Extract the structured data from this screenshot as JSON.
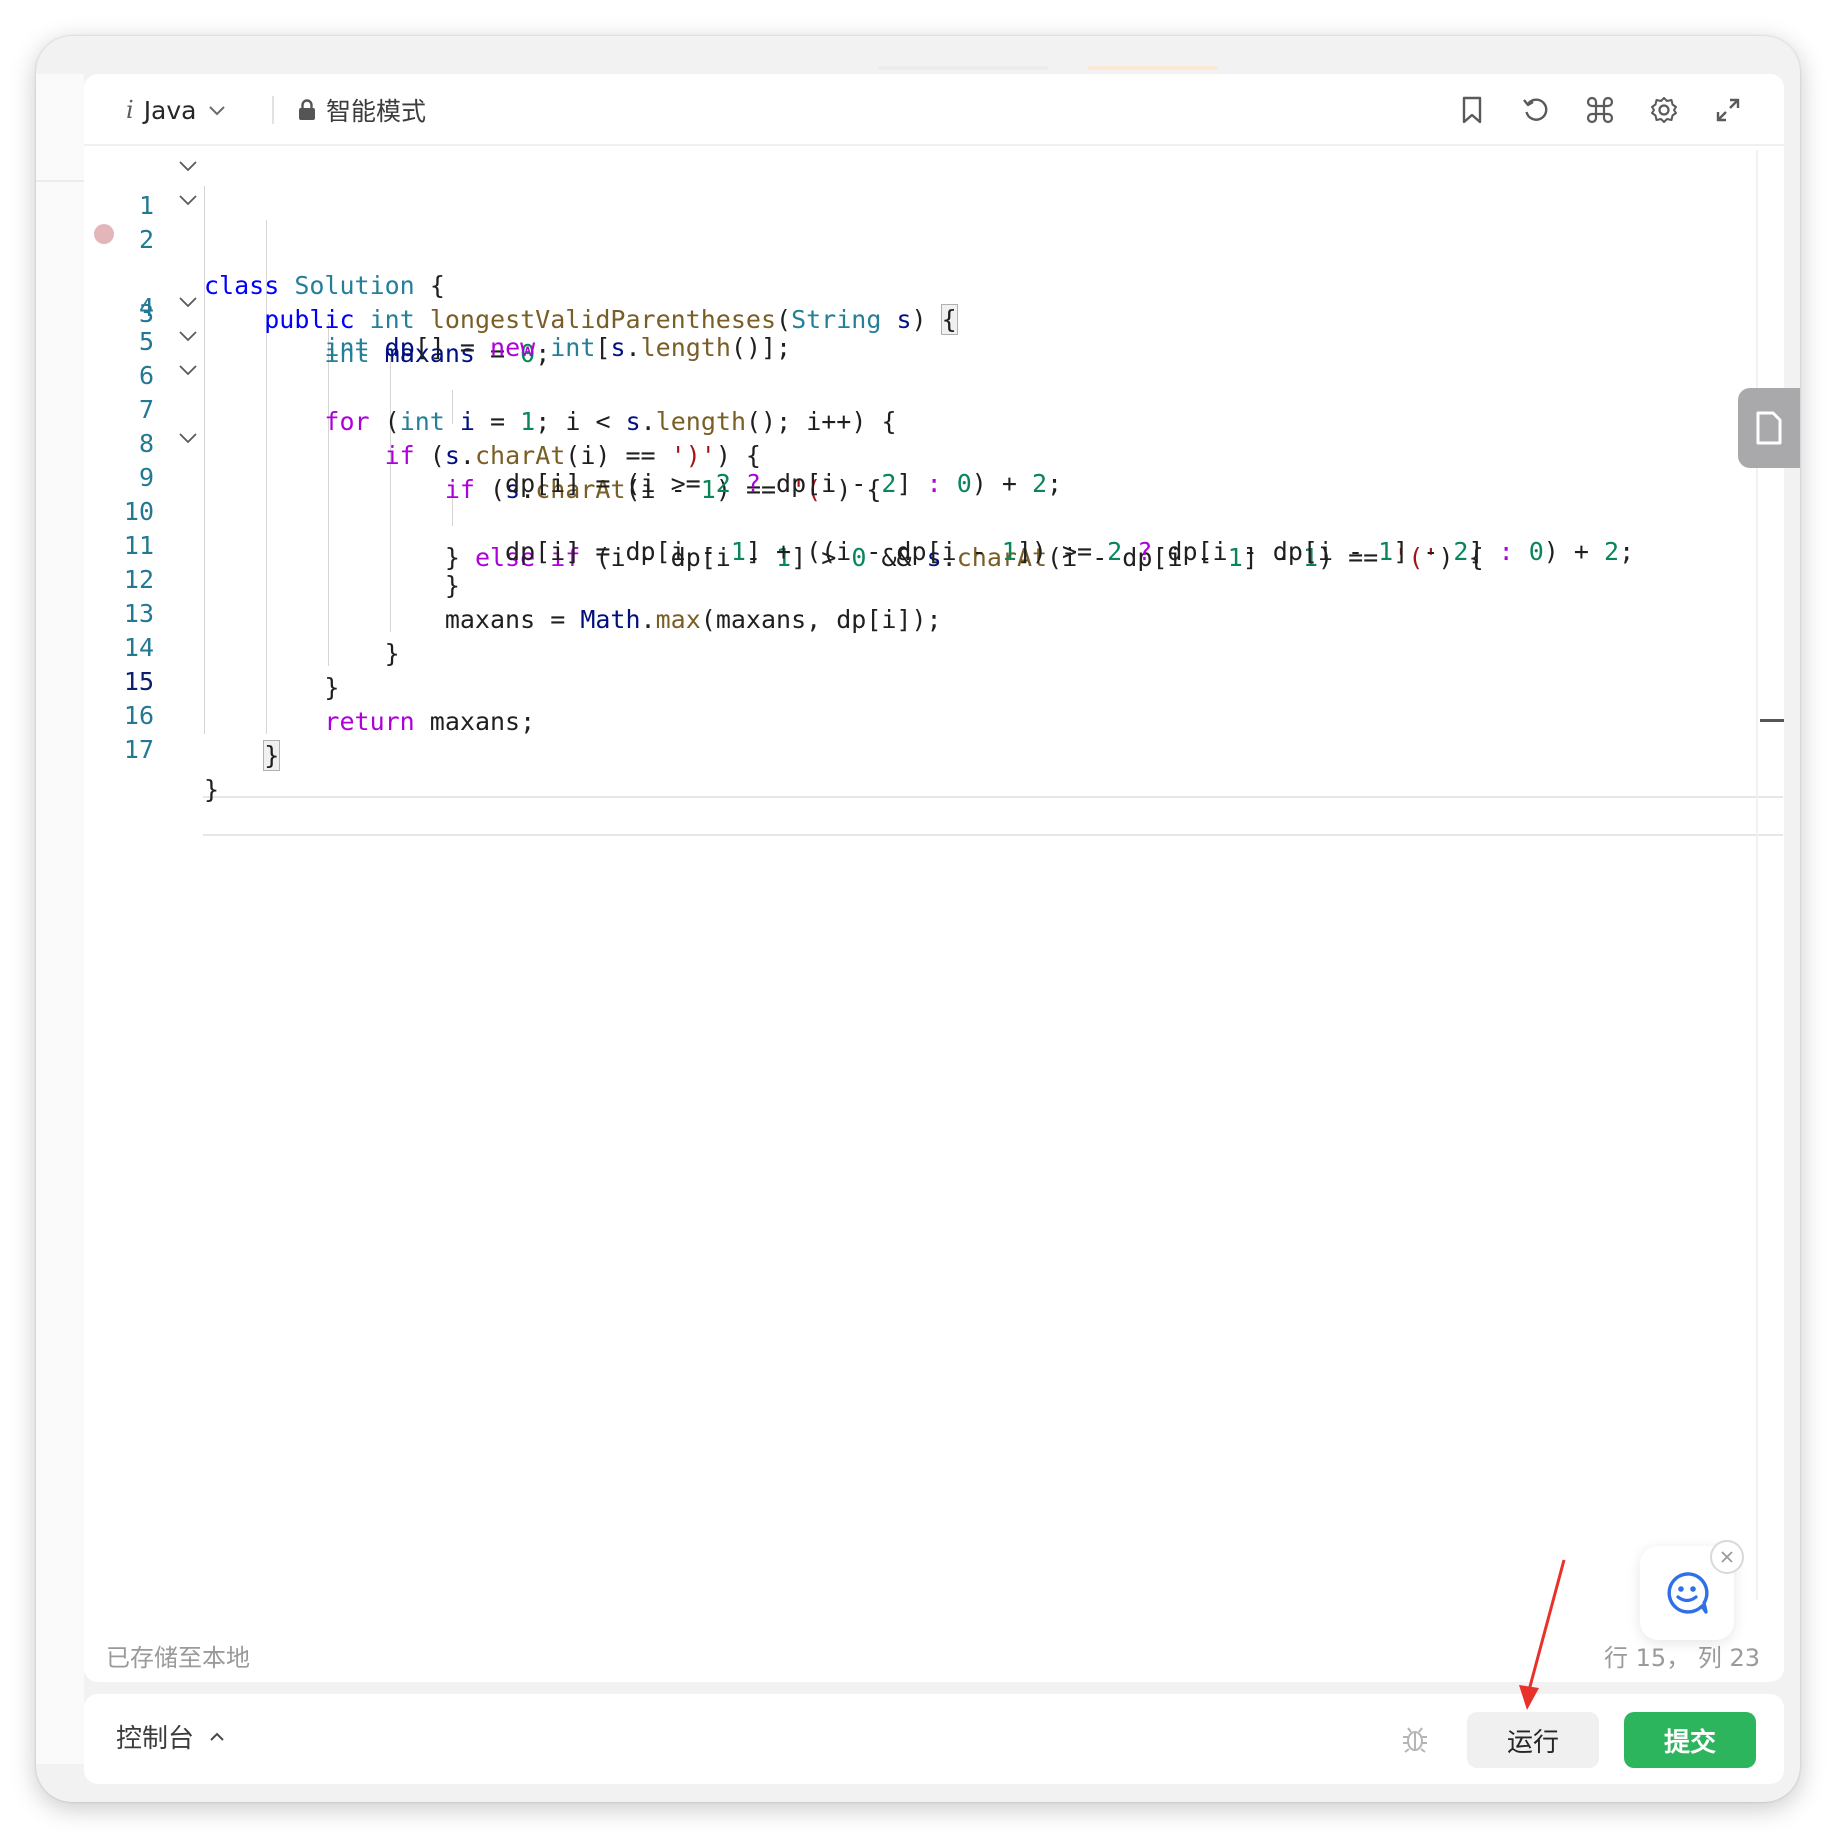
{
  "toolbar": {
    "language": "Java",
    "mode": "智能模式"
  },
  "editor": {
    "lines": [
      "1",
      "2",
      "3",
      "4",
      "5",
      "6",
      "7",
      "8",
      "9",
      "10",
      "11",
      "12",
      "13",
      "14",
      "15",
      "16",
      "17"
    ],
    "code": {
      "l1": [
        "class",
        "Solution",
        "{"
      ],
      "l2": [
        "public",
        "int",
        "longestValidParentheses",
        "(",
        "String",
        "s",
        ")",
        "{"
      ],
      "l3": [
        "int",
        "maxans",
        "=",
        "0",
        ";"
      ],
      "l4": [
        "int",
        "dp",
        "[] =",
        "new",
        "int",
        "[",
        "s",
        ".",
        "length",
        "()];"
      ],
      "l5": [
        "for",
        "(",
        "int",
        "i",
        "=",
        "1",
        "; i <",
        "s",
        ".",
        "length",
        "(); i++) {"
      ],
      "l6": [
        "if",
        "(",
        "s",
        ".",
        "charAt",
        "(i) ==",
        "')'",
        ") {"
      ],
      "l7": [
        "if",
        "(",
        "s",
        ".",
        "charAt",
        "(i -",
        "1",
        ") ==",
        "'('",
        ") {"
      ],
      "l8": [
        "dp[i] = (i >=",
        "2",
        "?",
        "dp[i -",
        "2",
        "]",
        ":",
        "0",
        ") +",
        "2",
        ";"
      ],
      "l9": [
        "} ",
        "else",
        "if",
        "(i - dp[i -",
        "1",
        "] >",
        "0",
        "&&",
        "s",
        ".",
        "charAt",
        "(i - dp[i -",
        "1",
        "] -",
        "1",
        ") ==",
        "'('",
        ") {"
      ],
      "l10": [
        "dp[i] = dp[i -",
        "1",
        "] + ((i - dp[i -",
        "1",
        "]) >=",
        "2",
        "?",
        "dp[i - dp[i -",
        "1",
        "] -",
        "2",
        "]",
        ":",
        "0",
        ") +",
        "2",
        ";"
      ],
      "l11": [
        "}"
      ],
      "l12": [
        "maxans",
        "=",
        "Math",
        ".",
        "max",
        "(maxans, dp[i]);"
      ],
      "l13": [
        "}"
      ],
      "l14": [
        "}"
      ],
      "l15": [
        "return",
        "maxans",
        ";"
      ],
      "l16": [
        "}"
      ],
      "l17": [
        "}"
      ]
    },
    "saved_status": "已存储至本地",
    "cursor_position": "行 15， 列 23"
  },
  "bottom": {
    "console_label": "控制台",
    "run_label": "运行",
    "submit_label": "提交"
  },
  "colors": {
    "submit": "#2db55d",
    "keyword": "#0000ff",
    "control": "#af00db",
    "type": "#267f99",
    "function": "#795e26",
    "number": "#098658",
    "string": "#a31515",
    "annotation_arrow": "#e8312a"
  },
  "icons": [
    "chevron-down-icon",
    "lock-icon",
    "bookmark-icon",
    "reset-icon",
    "command-icon",
    "settings-icon",
    "expand-icon",
    "fold-chevron-icon",
    "breakpoint-icon",
    "document-icon",
    "assistant-face-icon",
    "close-icon",
    "chevron-up-icon",
    "bug-icon",
    "red-arrow-annotation"
  ]
}
